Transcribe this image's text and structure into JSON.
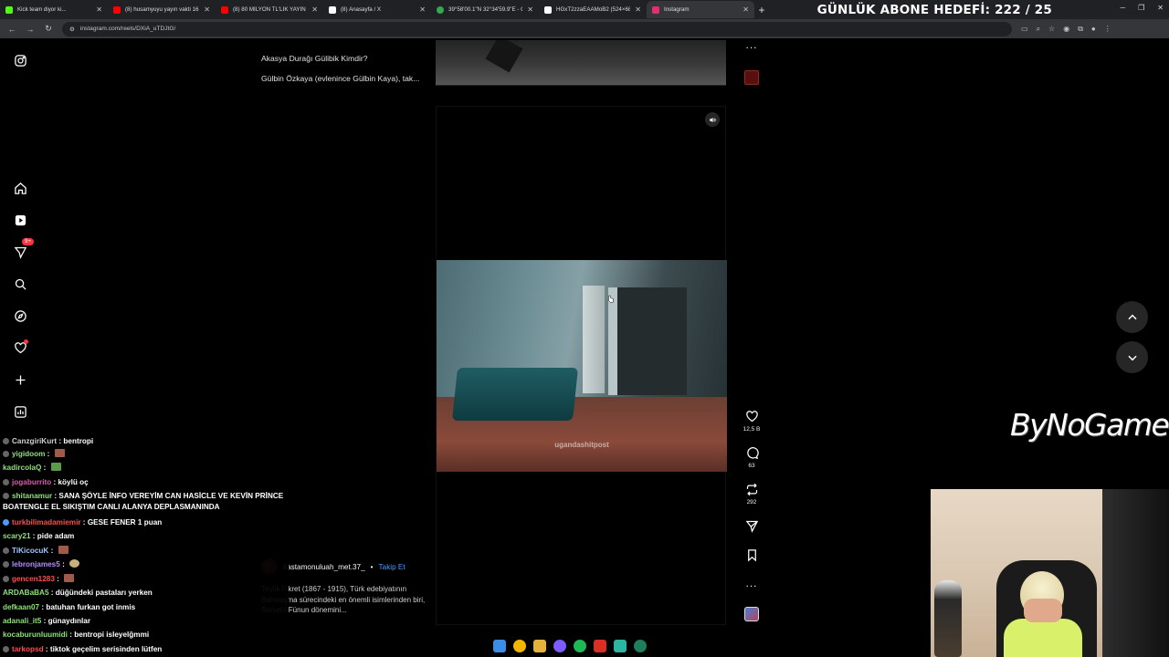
{
  "browser": {
    "tabs": [
      {
        "title": "Kick team diyor ki...",
        "color": "#53fc18"
      },
      {
        "title": "(8) husamyuyu yayın vakti 16 -",
        "color": "#ff0000"
      },
      {
        "title": "(8) 80 MİLYON TL'LİK YAYIN",
        "color": "#ff0000"
      },
      {
        "title": "(8) Anasayfa / X",
        "color": "#ffffff"
      },
      {
        "title": "39°58'00.1\"N 32°34'59.9\"E - Go",
        "color": "#34a853"
      },
      {
        "title": "HGxT2zzaEAAMoB2 (524×680)",
        "color": "#ffffff"
      },
      {
        "title": "Instagram",
        "color": "#e1306c"
      }
    ],
    "url": "instagram.com/reels/DXiA_uTDJtG/"
  },
  "overlay": {
    "goal": "GÜNLÜK ABONE HEDEFİ: 222 / 25",
    "brand": "ByNoGame"
  },
  "sidebar": {
    "notifications_badge": "9+",
    "icons": [
      "instagram-icon",
      "home-icon",
      "reels-icon",
      "messages-icon",
      "search-icon",
      "explore-icon",
      "heart-icon",
      "create-icon",
      "dashboard-icon"
    ]
  },
  "prev_reel": {
    "title": "Akasya Durağı Gülibik Kimdir?",
    "snippet": "Gülbin Özkaya (evlenince Gülbin Kaya), tak..."
  },
  "reel": {
    "watermark": "ugandashitpost",
    "author": "kastamonuluah_met.37_",
    "separator": "•",
    "follow": "Takip Et",
    "description": "Tevfik Fikret (1867 - 1915), Türk edebiyatının Batılılaşma sürecindeki en önemli isimlerinden biri, Servet-i Fünun dönemini...",
    "likes": "12,5 B",
    "comments": "63",
    "reposts": "292",
    "more": "..."
  },
  "chat": [
    {
      "user": "CanzgiriKurt",
      "text": "bentropi",
      "color": "#d0d0d0"
    },
    {
      "user": "yigidoom",
      "text": "",
      "color": "#8fe07a",
      "emote": true
    },
    {
      "user": "kadircolaQ",
      "text": "",
      "color": "#8fe07a",
      "emote": true
    },
    {
      "user": "jogaburrito",
      "text": "köylü oç",
      "color": "#e05ab0"
    },
    {
      "user": "shitanamur",
      "text": "SANA ŞÖYLE İNFO VEREYİM CAN HASİCLE VE KEVİN PRİNCE BOATENGLE EL SIKIŞTIM CANLI ALANYA DEPLASMANINDA",
      "color": "#8fe07a"
    },
    {
      "user": "turkbilimadamiemir",
      "text": "GESE FENER 1 puan",
      "color": "#ff4d4d"
    },
    {
      "user": "scary21",
      "text": "pide adam",
      "color": "#8fe07a"
    },
    {
      "user": "TiKicocuK",
      "text": "",
      "color": "#9ec6ff",
      "emote": true
    },
    {
      "user": "lebronjames5",
      "text": "",
      "color": "#b48cff",
      "emote": true
    },
    {
      "user": "gencen1283",
      "text": "",
      "color": "#ff4d4d",
      "emote": true
    },
    {
      "user": "ARDABaBA5",
      "text": "düğündeki pastaları yerken",
      "color": "#8fe07a"
    },
    {
      "user": "defkaan07",
      "text": "batuhan furkan got inmis",
      "color": "#8fe07a"
    },
    {
      "user": "adanali_it5",
      "text": "günaydınlar",
      "color": "#8fe07a"
    },
    {
      "user": "kocaburunluumidi",
      "text": "bentropi isleyelğmmi",
      "color": "#8fe07a"
    },
    {
      "user": "tarkopsd",
      "text": "tiktok geçelim serisinden lütfen",
      "color": "#ff4d4d"
    }
  ]
}
